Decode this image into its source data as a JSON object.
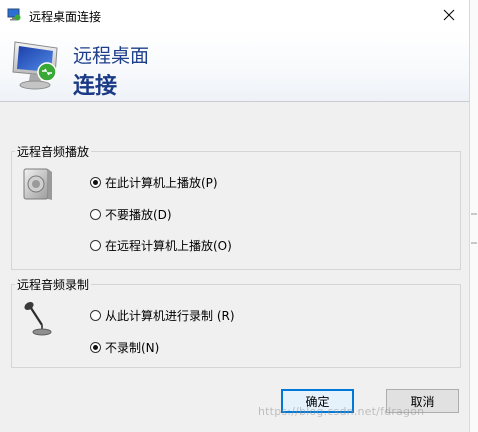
{
  "window": {
    "title": "远程桌面连接"
  },
  "banner": {
    "line1": "远程桌面",
    "line2": "连接"
  },
  "playback": {
    "group_title": "远程音频播放",
    "options": [
      {
        "label": "在此计算机上播放(P)",
        "checked": true
      },
      {
        "label": "不要播放(D)",
        "checked": false
      },
      {
        "label": "在远程计算机上播放(O)",
        "checked": false
      }
    ]
  },
  "recording": {
    "group_title": "远程音频录制",
    "options": [
      {
        "label": "从此计算机进行录制 (R)",
        "checked": false
      },
      {
        "label": "不录制(N)",
        "checked": true
      }
    ]
  },
  "buttons": {
    "ok_label": "确定",
    "cancel_label": "取消"
  },
  "watermark": "https://blog.csdn.net/fdragon",
  "colors": {
    "accent": "#0078d7",
    "banner_text": "#1e3f8a"
  }
}
